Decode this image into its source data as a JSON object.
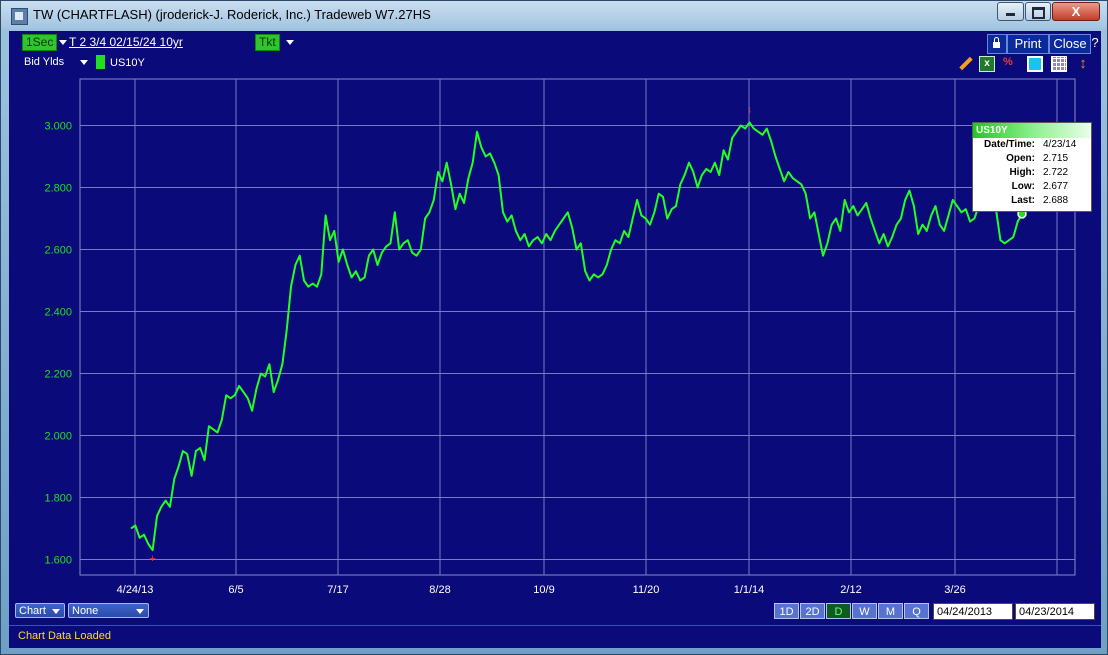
{
  "window": {
    "title": "TW  (CHARTFLASH) (jroderick-J. Roderick, Inc.) Tradeweb W7.27HS",
    "close_glyph": "X"
  },
  "toolbar": {
    "interval_label": "1Sec",
    "instrument_label": "T  2 3/4 02/15/24 10yr",
    "ticket_label": "Tkt",
    "print_label": "Print",
    "close_label": "Close",
    "help_label": "?",
    "price_type_label": "Bid Ylds",
    "legend_label": "US10Y",
    "legend_color": "#22dd22",
    "icons": [
      "pencil-icon",
      "excel-icon",
      "percent-icon",
      "square-icon",
      "grid-icon",
      "up-down-arrows-icon"
    ]
  },
  "tooltip": {
    "title": "US10Y",
    "rows": [
      {
        "label": "Date/Time:",
        "value": "4/23/14"
      },
      {
        "label": "Open:",
        "value": "2.715"
      },
      {
        "label": "High:",
        "value": "2.722"
      },
      {
        "label": "Low:",
        "value": "2.677"
      },
      {
        "label": "Last:",
        "value": "2.688"
      }
    ]
  },
  "bottom": {
    "chart_dropdown": "Chart",
    "study_dropdown": "None",
    "periods": [
      "1D",
      "2D",
      "D",
      "W",
      "M",
      "Q"
    ],
    "active_period": "D",
    "start_date": "04/24/2013",
    "end_date": "04/23/2014"
  },
  "status": {
    "text": "Chart Data Loaded"
  },
  "chart_data": {
    "type": "line",
    "x_tick_labels": [
      "4/24/13",
      "6/5",
      "7/17",
      "8/28",
      "10/9",
      "11/20",
      "1/1/14",
      "2/12",
      "3/26"
    ],
    "y_tick_labels": [
      "1.600",
      "1.800",
      "2.000",
      "2.200",
      "2.400",
      "2.600",
      "2.800",
      "3.000"
    ],
    "ylim": [
      1.55,
      3.15
    ],
    "grid": true,
    "background": "#0a0a7a",
    "line_color": "#22ff22",
    "series": [
      {
        "values": [
          1.7,
          1.71,
          1.67,
          1.68,
          1.65,
          1.63,
          1.74,
          1.77,
          1.79,
          1.77,
          1.86,
          1.9,
          1.95,
          1.94,
          1.87,
          1.95,
          1.96,
          1.92,
          2.03,
          2.02,
          2.01,
          2.05,
          2.13,
          2.12,
          2.13,
          2.16,
          2.14,
          2.12,
          2.08,
          2.15,
          2.2,
          2.19,
          2.23,
          2.14,
          2.18,
          2.23,
          2.34,
          2.48,
          2.55,
          2.58,
          2.5,
          2.48,
          2.49,
          2.48,
          2.52,
          2.71,
          2.63,
          2.66,
          2.56,
          2.6,
          2.55,
          2.51,
          2.53,
          2.5,
          2.51,
          2.58,
          2.6,
          2.55,
          2.59,
          2.61,
          2.62,
          2.72,
          2.6,
          2.62,
          2.63,
          2.59,
          2.58,
          2.6,
          2.7,
          2.72,
          2.76,
          2.85,
          2.82,
          2.88,
          2.81,
          2.73,
          2.78,
          2.75,
          2.83,
          2.88,
          2.98,
          2.93,
          2.9,
          2.91,
          2.88,
          2.84,
          2.72,
          2.69,
          2.71,
          2.66,
          2.63,
          2.65,
          2.61,
          2.63,
          2.64,
          2.62,
          2.65,
          2.63,
          2.66,
          2.68,
          2.7,
          2.72,
          2.67,
          2.6,
          2.62,
          2.53,
          2.5,
          2.52,
          2.51,
          2.52,
          2.55,
          2.6,
          2.63,
          2.62,
          2.66,
          2.64,
          2.7,
          2.76,
          2.71,
          2.7,
          2.68,
          2.72,
          2.78,
          2.77,
          2.7,
          2.73,
          2.74,
          2.81,
          2.84,
          2.88,
          2.85,
          2.8,
          2.84,
          2.86,
          2.85,
          2.88,
          2.84,
          2.92,
          2.89,
          2.96,
          2.98,
          3.0,
          2.99,
          3.01,
          2.99,
          2.98,
          2.97,
          2.99,
          2.95,
          2.9,
          2.86,
          2.82,
          2.85,
          2.83,
          2.82,
          2.81,
          2.78,
          2.7,
          2.72,
          2.65,
          2.58,
          2.62,
          2.68,
          2.7,
          2.66,
          2.76,
          2.72,
          2.74,
          2.71,
          2.73,
          2.75,
          2.7,
          2.66,
          2.62,
          2.65,
          2.61,
          2.64,
          2.68,
          2.7,
          2.76,
          2.79,
          2.74,
          2.65,
          2.68,
          2.66,
          2.71,
          2.74,
          2.68,
          2.66,
          2.71,
          2.76,
          2.74,
          2.72,
          2.73,
          2.69,
          2.7,
          2.74,
          2.78,
          2.82,
          2.76,
          2.73,
          2.63,
          2.62,
          2.63,
          2.64,
          2.69,
          2.715
        ]
      }
    ]
  }
}
